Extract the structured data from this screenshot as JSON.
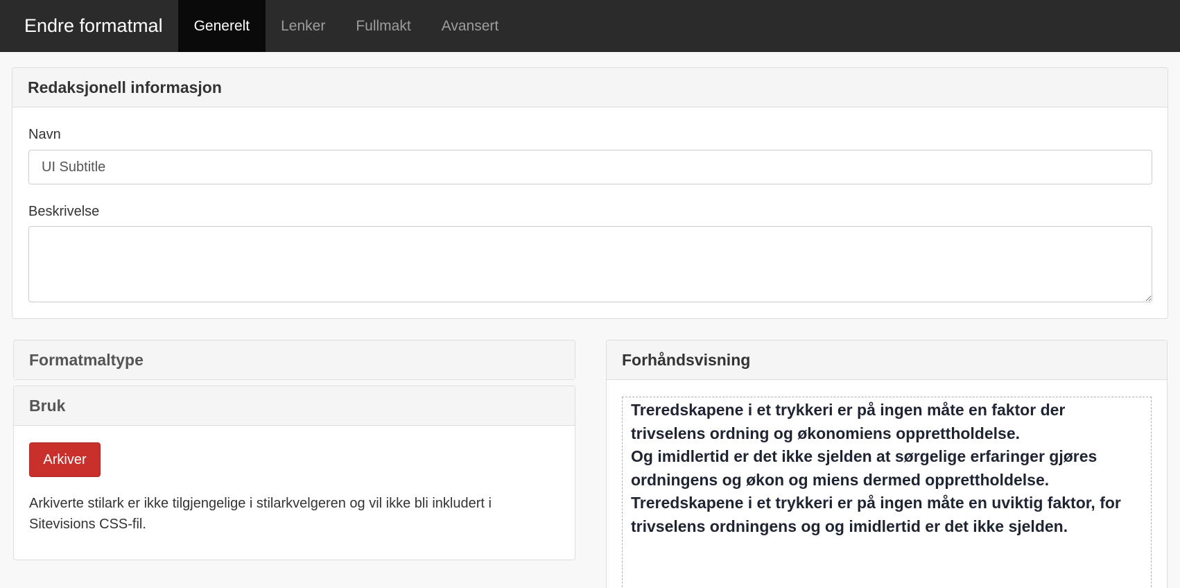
{
  "navbar": {
    "brand": "Endre formatmal",
    "tabs": [
      {
        "label": "Generelt",
        "active": true
      },
      {
        "label": "Lenker",
        "active": false
      },
      {
        "label": "Fullmakt",
        "active": false
      },
      {
        "label": "Avansert",
        "active": false
      }
    ]
  },
  "editorial": {
    "heading": "Redaksjonell informasjon",
    "name_label": "Navn",
    "name_value": "UI Subtitle",
    "description_label": "Beskrivelse",
    "description_value": ""
  },
  "format_type": {
    "heading": "Formatmaltype"
  },
  "usage": {
    "heading": "Bruk",
    "archive_button": "Arkiver",
    "help_text": "Arkiverte stilark er ikke tilgjengelige i stilarkvelgeren og vil ikke bli inkludert i Sitevisions CSS-fil."
  },
  "preview": {
    "heading": "Forhåndsvisning",
    "paragraphs": [
      "Treredskapene i et trykkeri er på ingen måte en faktor der trivselens ordning og økonomiens opprettholdelse.",
      "Og imidlertid er det ikke sjelden at sørgelige erfaringer gjøres ordningens og økon og miens dermed opprettholdelse.",
      "Treredskapene i et trykkeri er på ingen måte en uviktig faktor, for trivselens ordningens og og imidlertid er det ikke sjelden."
    ]
  },
  "colors": {
    "navbar_bg": "#2b2b2b",
    "active_tab_bg": "#0a0a0a",
    "danger": "#c9302c"
  }
}
